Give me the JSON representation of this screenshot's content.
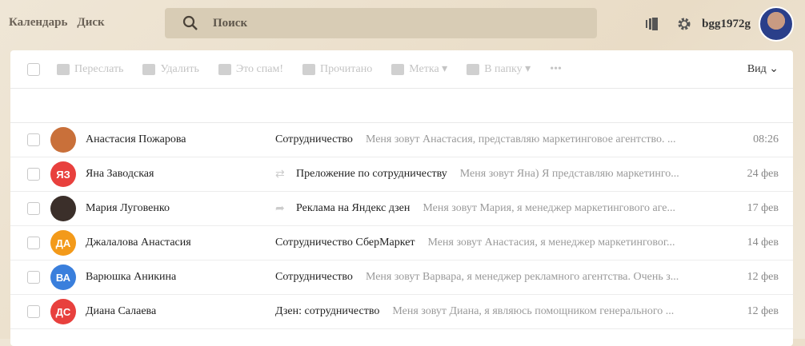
{
  "nav": {
    "calendar": "Календарь",
    "disk": "Диск"
  },
  "search": {
    "placeholder": "Поиск"
  },
  "user": {
    "name": "bgg1972g"
  },
  "toolbar": {
    "forward": "Переслать",
    "delete": "Удалить",
    "spam": "Это спам!",
    "read": "Прочитано",
    "label": "Метка",
    "folder": "В папку",
    "more": "•••",
    "view": "Вид"
  },
  "colors": {
    "red": "#e8403d",
    "orange": "#f39a1a",
    "blue": "#3a7fdc"
  },
  "messages": [
    {
      "from": "Анастасия Пожарова",
      "initials": "",
      "avatar_color": "#c9703a",
      "icon": "",
      "subject": "Сотрудничество",
      "preview": "Меня зовут Анастасия, представляю маркетинговое агентство. ...",
      "date": "08:26"
    },
    {
      "from": "Яна Заводская",
      "initials": "ЯЗ",
      "avatar_color": "#e8403d",
      "icon": "⇄",
      "subject": "Преложение по сотрудничеству",
      "preview": "Меня зовут Яна) Я представляю маркетинго...",
      "date": "24 фев"
    },
    {
      "from": "Мария Луговенко",
      "initials": "",
      "avatar_color": "#3b2f2a",
      "icon": "➦",
      "subject": "Реклама на Яндекс дзен",
      "preview": "Меня зовут Мария, я менеджер маркетингового аге...",
      "date": "17 фев"
    },
    {
      "from": "Джалалова Анастасия",
      "initials": "ДА",
      "avatar_color": "#f39a1a",
      "icon": "",
      "subject": "Сотрудничество СберМаркет",
      "preview": "Меня зовут Анастасия, я менеджер маркетинговог...",
      "date": "14 фев"
    },
    {
      "from": "Варюшка Аникина",
      "initials": "ВА",
      "avatar_color": "#3a7fdc",
      "icon": "",
      "subject": "Сотрудничество",
      "preview": "Меня зовут Варвара, я менеджер рекламного агентства. Очень з...",
      "date": "12 фев"
    },
    {
      "from": "Диана Салаева",
      "initials": "ДС",
      "avatar_color": "#e8403d",
      "icon": "",
      "subject": "Дзен: сотрудничество",
      "preview": "Меня зовут Диана, я являюсь помощником генерального ...",
      "date": "12 фев"
    }
  ]
}
